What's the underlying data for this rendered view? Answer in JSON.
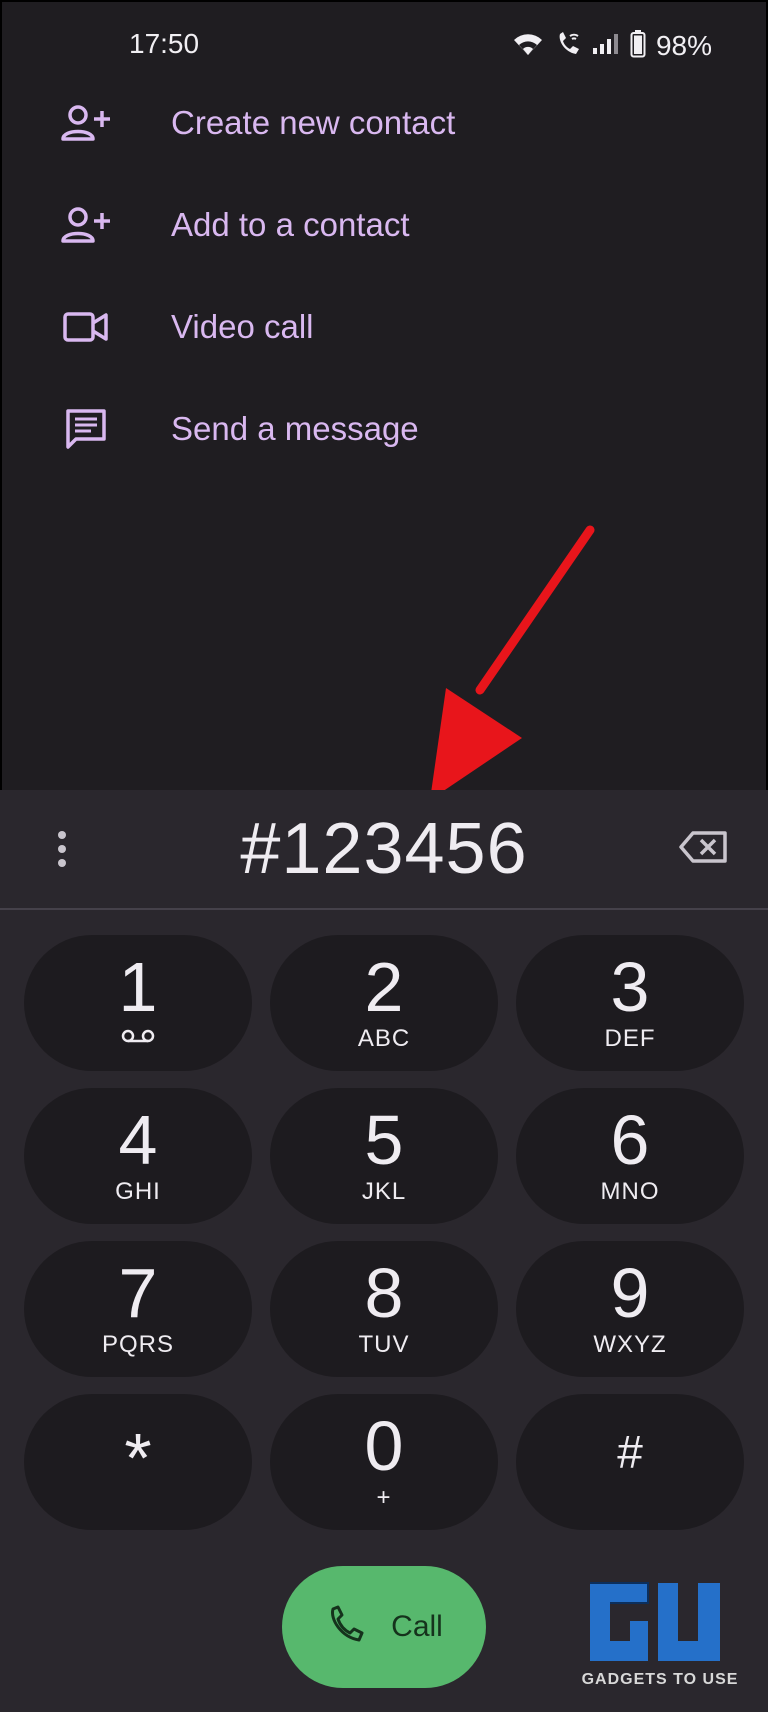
{
  "status_bar": {
    "time": "17:50",
    "battery": "98%"
  },
  "menu": {
    "items": [
      {
        "label": "Create new contact",
        "icon": "person-add-icon"
      },
      {
        "label": "Add to a contact",
        "icon": "person-add-icon"
      },
      {
        "label": "Video call",
        "icon": "videocam-icon"
      },
      {
        "label": "Send a message",
        "icon": "message-icon"
      }
    ]
  },
  "dialpad": {
    "digits": "#123456",
    "keys": [
      {
        "num": "1",
        "sub": ""
      },
      {
        "num": "2",
        "sub": "ABC"
      },
      {
        "num": "3",
        "sub": "DEF"
      },
      {
        "num": "4",
        "sub": "GHI"
      },
      {
        "num": "5",
        "sub": "JKL"
      },
      {
        "num": "6",
        "sub": "MNO"
      },
      {
        "num": "7",
        "sub": "PQRS"
      },
      {
        "num": "8",
        "sub": "TUV"
      },
      {
        "num": "9",
        "sub": "WXYZ"
      },
      {
        "num": "*",
        "sub": ""
      },
      {
        "num": "0",
        "sub": "+"
      },
      {
        "num": "#",
        "sub": ""
      }
    ]
  },
  "call_button": {
    "label": "Call"
  },
  "watermark": {
    "text": "GADGETS TO USE"
  },
  "colors": {
    "accent": "#d9b8f0",
    "call": "#57b86d",
    "annotation_arrow": "#e8151b"
  }
}
